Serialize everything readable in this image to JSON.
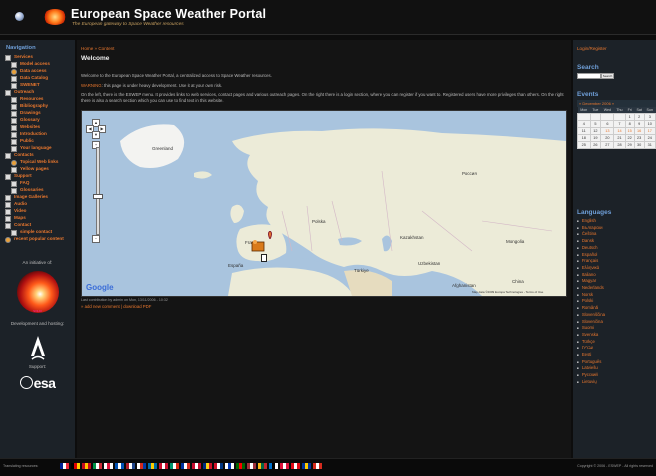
{
  "header": {
    "title": "European Space Weather Portal",
    "subtitle": "The European gateway to Space Weather resources"
  },
  "left_nav": {
    "heading": "Navigation",
    "items": [
      {
        "label": "Services",
        "level": 0,
        "icon": "square"
      },
      {
        "label": "Model access",
        "level": 1,
        "icon": "square"
      },
      {
        "label": "Data access",
        "level": 1,
        "icon": "gear"
      },
      {
        "label": "Data Catalog",
        "level": 1,
        "icon": "square"
      },
      {
        "label": "SWENET",
        "level": 1,
        "icon": "square"
      },
      {
        "label": "Outreach",
        "level": 0,
        "icon": "square"
      },
      {
        "label": "Resources",
        "level": 1,
        "icon": "square"
      },
      {
        "label": "Bibliography",
        "level": 1,
        "icon": "square"
      },
      {
        "label": "Drawings",
        "level": 1,
        "icon": "square"
      },
      {
        "label": "Glossary",
        "level": 1,
        "icon": "square"
      },
      {
        "label": "Websites",
        "level": 1,
        "icon": "square"
      },
      {
        "label": "Introduction",
        "level": 1,
        "icon": "square"
      },
      {
        "label": "Public",
        "level": 1,
        "icon": "square"
      },
      {
        "label": "Your language",
        "level": 1,
        "icon": "square"
      },
      {
        "label": "Contacts",
        "level": 0,
        "icon": "square"
      },
      {
        "label": "Topical Web links",
        "level": 1,
        "icon": "gear"
      },
      {
        "label": "Yellow pages",
        "level": 1,
        "icon": "square"
      },
      {
        "label": "Support",
        "level": 0,
        "icon": "square"
      },
      {
        "label": "FAQ",
        "level": 1,
        "icon": "square"
      },
      {
        "label": "Glossaries",
        "level": 1,
        "icon": "square"
      },
      {
        "label": "Image Galleries",
        "level": 0,
        "icon": "square"
      },
      {
        "label": "Audio",
        "level": 0,
        "icon": "square"
      },
      {
        "label": "Video",
        "level": 0,
        "icon": "square"
      },
      {
        "label": "Maps",
        "level": 0,
        "icon": "square"
      },
      {
        "label": "Contact",
        "level": 0,
        "icon": "square"
      },
      {
        "label": "simple contact",
        "level": 1,
        "icon": "square"
      },
      {
        "label": "recent popular content",
        "level": 0,
        "icon": "gear"
      }
    ]
  },
  "initiative": {
    "label": "An initiative of:",
    "sun_caption": "SOHO",
    "dev_label": "Development and hosting:",
    "support_label": "Support:",
    "esa_label": "esa"
  },
  "main": {
    "breadcrumb": "Home » Content",
    "title": "Welcome",
    "p1": "Welcome to the European Space Weather Portal, a centralized access to Space Weather resources.",
    "p2_warn": "WARNING",
    "p2_rest": ": this page is under heavy development. Use it at your own risk.",
    "p3": "On the left, there is the ESWEP menu. It provides links to web services, contact pages and various outreach pages. On the right there is a login section, where you can register if you want to. Registered users have more privileges than others. On the right there is also a search section which you can use to find text in this website.",
    "map": {
      "labels": {
        "greenland": "Greenland",
        "russia": "Россия",
        "kazakhstan": "Kazakhstan",
        "mongolia": "Mongolia",
        "china": "China",
        "france": "France",
        "espana": "España",
        "polska": "Polska",
        "turkiye": "Türkiye",
        "uzbekistan": "Uzbekistan",
        "afghanistan": "Afghanistan"
      },
      "provider": "Google",
      "copyright": "Map data ©2009 Europa Technologies - Terms of Use"
    },
    "last_contrib": "Last contribution by admin on Mon, 13/11/2006 - 10:32",
    "links": "» add new comment | download PDF"
  },
  "right": {
    "login": "Login/Register",
    "search_heading": "Search",
    "search_button": "Search",
    "events_heading": "Events",
    "calendar_title": "« December 2006 »",
    "weekdays": [
      "Mon",
      "Tue",
      "Wed",
      "Thu",
      "Fri",
      "Sat",
      "Sun"
    ],
    "weeks": [
      [
        "",
        "",
        "",
        "",
        "1",
        "2",
        "3"
      ],
      [
        "4",
        "5",
        "6",
        "7",
        "8",
        "9",
        "10"
      ],
      [
        "11",
        "12",
        "13",
        "14",
        "15",
        "16",
        "17"
      ],
      [
        "18",
        "19",
        "20",
        "21",
        "22",
        "23",
        "24"
      ],
      [
        "25",
        "26",
        "27",
        "28",
        "29",
        "30",
        "31"
      ]
    ],
    "languages_heading": "Languages",
    "languages": [
      "English",
      "Български",
      "Čeština",
      "Dansk",
      "Deutsch",
      "Español",
      "Français",
      "Ελληνικά",
      "Italiano",
      "Magyar",
      "Nederlands",
      "Norsk",
      "Polski",
      "Română",
      "Slovenščina",
      "Slovenčina",
      "Suomi",
      "Svenska",
      "Türkçe",
      "עברית",
      "Eesti",
      "Português",
      "Latviešu",
      "Русский",
      "Lietuvių"
    ]
  },
  "footer": {
    "left": "Translating resources:",
    "right": "Copyright © 2006 - ESWEP - All rights reserved"
  }
}
